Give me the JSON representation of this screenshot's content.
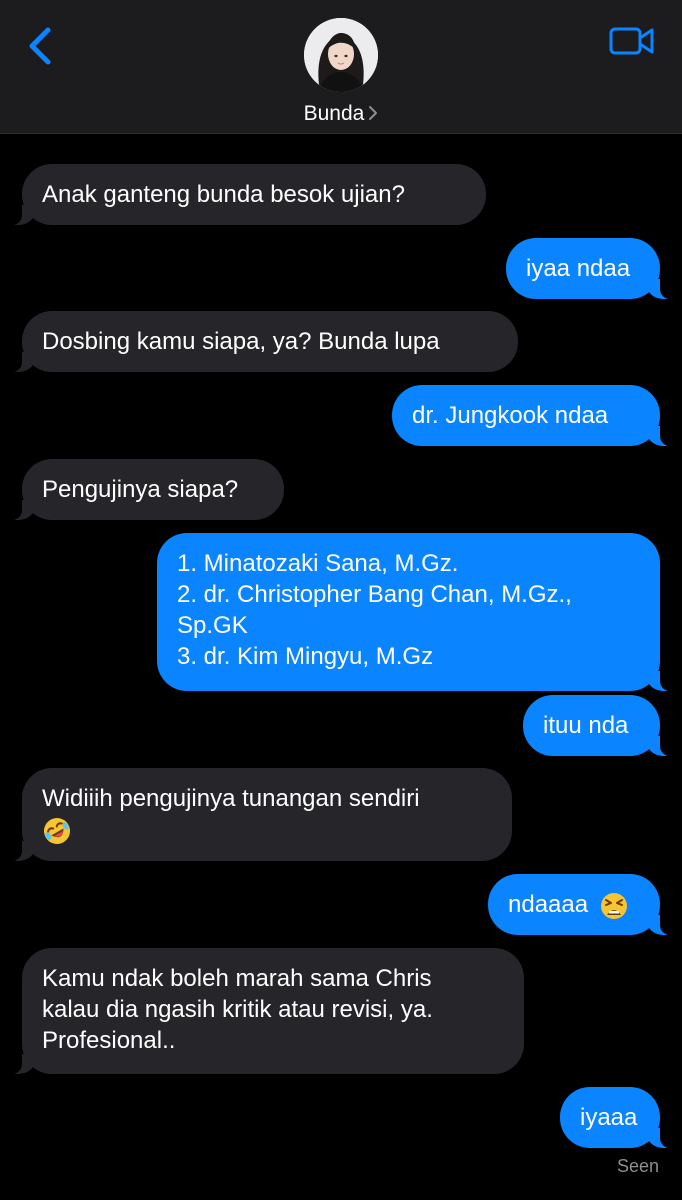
{
  "header": {
    "contact_name": "Bunda",
    "back_icon": "chevron-left-icon",
    "video_icon": "video-camera-icon",
    "accent_color": "#0a84ff"
  },
  "messages": [
    {
      "direction": "incoming",
      "lines": [
        "Anak ganteng bunda besok ujian?"
      ]
    },
    {
      "direction": "outgoing",
      "lines": [
        "iyaa ndaa"
      ]
    },
    {
      "direction": "incoming",
      "lines": [
        "Dosbing kamu siapa, ya? Bunda lupa"
      ]
    },
    {
      "direction": "outgoing",
      "lines": [
        "dr. Jungkook ndaa"
      ]
    },
    {
      "direction": "incoming",
      "lines": [
        "Pengujinya siapa?"
      ]
    },
    {
      "direction": "outgoing",
      "lines": [
        "1. Minatozaki Sana, M.Gz.",
        "2. dr. Christopher Bang Chan, M.Gz.,",
        "Sp.GK",
        "3. dr. Kim Mingyu, M.Gz"
      ]
    },
    {
      "direction": "outgoing",
      "lines": [
        "ituu nda"
      ]
    },
    {
      "direction": "incoming",
      "lines": [
        "Widiiih pengujinya tunangan sendiri"
      ],
      "emoji": "rolling-on-floor-laughing-emoji"
    },
    {
      "direction": "outgoing",
      "lines": [
        "ndaaaa"
      ],
      "emoji": "tired-face-emoji"
    },
    {
      "direction": "incoming",
      "lines": [
        "Kamu ndak boleh marah sama Chris",
        "kalau dia ngasih kritik atau revisi, ya.",
        "Profesional.."
      ]
    },
    {
      "direction": "outgoing",
      "lines": [
        "iyaaa"
      ]
    }
  ],
  "status": {
    "read_receipt": "Seen"
  }
}
